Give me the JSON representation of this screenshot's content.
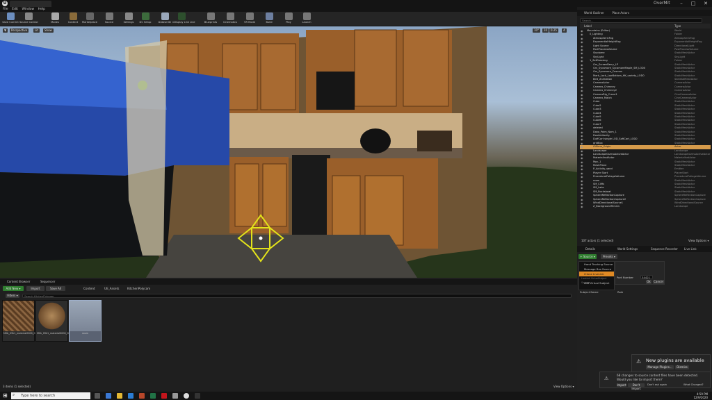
{
  "window": {
    "project": "OverMit",
    "min": "–",
    "max": "□",
    "close": "✕"
  },
  "menu": [
    "File",
    "Edit",
    "Window",
    "Help"
  ],
  "toolbar": [
    {
      "label": "Save Current",
      "icon": "save-icon",
      "color": "#6c8ebf"
    },
    {
      "label": "Source Control",
      "icon": "source-control-icon",
      "color": "#888"
    },
    {
      "label": "Modes",
      "icon": "modes-icon",
      "color": "#aaa"
    },
    {
      "label": "Content",
      "icon": "content-icon",
      "color": "#8a6b3a"
    },
    {
      "label": "Marketplace",
      "icon": "marketplace-icon",
      "color": "#666"
    },
    {
      "label": "Source",
      "icon": "source-icon",
      "color": "#777"
    },
    {
      "label": "Settings",
      "icon": "settings-icon",
      "color": "#888"
    },
    {
      "label": "DC Setup",
      "icon": "dc-setup-icon",
      "color": "#3c6b3c"
    },
    {
      "label": "Datasmith",
      "icon": "datasmith-icon",
      "color": "#9aa8bb"
    },
    {
      "label": "nDisplay Link Live",
      "icon": "ndisplay-icon",
      "color": "#2d4f2d"
    },
    {
      "label": "Blueprints",
      "icon": "blueprints-icon",
      "color": "#777"
    },
    {
      "label": "Cinematics",
      "icon": "cinematics-icon",
      "color": "#777"
    },
    {
      "label": "VR Mode",
      "icon": "vr-mode-icon",
      "color": "#777"
    },
    {
      "label": "Build",
      "icon": "build-icon",
      "color": "#6d7fa0"
    },
    {
      "label": "Play",
      "icon": "play-icon",
      "color": "#777"
    },
    {
      "label": "Launch",
      "icon": "launch-icon",
      "color": "#777"
    }
  ],
  "viewport": {
    "perspective": "Perspective",
    "lit": "Lit",
    "show": "Show",
    "snap1": "10°",
    "snap2": "10",
    "speed": "0.25",
    "cam": "4"
  },
  "outliner": {
    "tabs": [
      "World Outliner",
      "Place Actors"
    ],
    "search_placeholder": "Search...",
    "col_label": "Label",
    "col_type": "Type",
    "rows": [
      [
        "Mountains (Editor)",
        "World"
      ],
      [
        "0_Lighting",
        "Folder"
      ],
      [
        "AtmosphericFog",
        "AtmosphericFog"
      ],
      [
        "ExponentialHeightFog",
        "ExponentialHeightFog"
      ],
      [
        "Light Source",
        "DirectionalLight"
      ],
      [
        "PostProcessVolume",
        "PostProcessVolume"
      ],
      [
        "Skydome",
        "StaticMeshActor"
      ],
      [
        "SkyLight",
        "SkyLight"
      ],
      [
        "1_SetDressing",
        "Folder"
      ],
      [
        "Grs_ScreenBerry_LP",
        "StaticMeshActor"
      ],
      [
        "Grs_Sycamore_SycamoreMaple_SM_LOD0",
        "StaticMeshActor"
      ],
      [
        "Grs_Sycamore_Cosmos",
        "StaticMeshActor"
      ],
      [
        "Mark_Lock_LowBottom_HK_variety_LOD0",
        "StaticMeshActor"
      ],
      [
        "Bird_Animation",
        "SkeletalMeshActor"
      ],
      [
        "CameraActor",
        "CameraActor"
      ],
      [
        "Camera_Chimney",
        "CameraActor"
      ],
      [
        "Camera_Chimney2",
        "CameraActor"
      ],
      [
        "CameraRig_Crane1",
        "CineCameraActor"
      ],
      [
        "Camera_Match",
        "CineCameraActor"
      ],
      [
        "Cube",
        "StaticMeshActor"
      ],
      [
        "Cube2",
        "StaticMeshActor"
      ],
      [
        "Cube3",
        "StaticMeshActor"
      ],
      [
        "Cube4",
        "StaticMeshActor"
      ],
      [
        "Cube5",
        "StaticMeshActor"
      ],
      [
        "Cube6",
        "StaticMeshActor"
      ],
      [
        "Cube7",
        "StaticMeshActor"
      ],
      [
        "deleted",
        "StaticMeshActor"
      ],
      [
        "Dako_Palm_Nom_1",
        "StaticMeshActor"
      ],
      [
        "DoubleVanity",
        "StaticMeshActor"
      ],
      [
        "DuffCart single LOD_SoftCart_LOD0",
        "StaticMeshActor"
      ],
      [
        "gridBox",
        "StaticMeshActor"
      ],
      [
        "iOSime_Origin",
        "Actor"
      ],
      [
        "Landscape",
        "Landscape"
      ],
      [
        "LandscapeGizmoActiveActor",
        "LandscapeGizmoActiveActor"
      ],
      [
        "MaterialInstActor",
        "MaterialInstActor"
      ],
      [
        "Mpc_1",
        "StaticMeshActor"
      ],
      [
        "MeshPlane",
        "StaticMeshActor"
      ],
      [
        "P_Activity_sand",
        "Emitter"
      ],
      [
        "Player Start",
        "PlayerStart"
      ],
      [
        "ProceduralFoliageVolume",
        "ProceduralFoliageVolume"
      ],
      [
        "room",
        "StaticMeshActor"
      ],
      [
        "SM_Cliffs",
        "StaticMeshActor"
      ],
      [
        "SM_Lake",
        "StaticMeshActor"
      ],
      [
        "SM_Rocksboat",
        "StaticMeshActor"
      ],
      [
        "SphereReflectionCapture",
        "SphereReflectionCapture"
      ],
      [
        "SphereReflectionCapture2",
        "SphereReflectionCapture"
      ],
      [
        "WindDirectionalSource1",
        "WindDirectionalSource"
      ],
      [
        "Z_BackgroundTerrain",
        "Landscape"
      ]
    ],
    "selected": 31,
    "status": "107 actors (1 selected)",
    "view_options": "View Options ▾"
  },
  "details": {
    "tabs": [
      "Details",
      "World Settings",
      "Sequence Recorder",
      "Live Link"
    ],
    "source_btn": "+ Source ▾",
    "presets_btn": "Presets ▾",
    "menu": [
      "Hand Tracking Source",
      "Message Bus Source",
      "iClone LiveLink"
    ],
    "port_label": "Port Number",
    "port_value": "34421",
    "ok": "Ok",
    "cancel": "Cancel",
    "vs_header": "LiveLink VirtualSubject Sources",
    "add_vs": "Add Virtual Subject",
    "subject_label": "Subject Name",
    "subject_value": "Role"
  },
  "notify": {
    "title": "New plugins are available",
    "manage": "Manage Plugins...",
    "dismiss": "Dismiss",
    "msg1": "68 changes to source content files have been detected.",
    "msg2": "Would you like to import them?",
    "import": "Import",
    "dont": "Don't Import",
    "dontask": "Don't ask again",
    "what": "What Changed?"
  },
  "browser": {
    "tabs": [
      "Content Browser",
      "Sequencer"
    ],
    "add_new": "Add New ▾",
    "import": "Import",
    "save_all": "Save All",
    "path": [
      "Content",
      "UE_Assets",
      "KitchenPolycam"
    ],
    "filters": "Filters ▾",
    "search_placeholder": "Search KitchenPolycam",
    "assets": [
      {
        "name": "M0b_09k1_material0000_001_fib_dict_diffuse"
      },
      {
        "name": "M0k_09k1_material0000_001_baked"
      },
      {
        "name": "room"
      }
    ],
    "status": "3 items (1 selected)",
    "view_options": "View Options ▾"
  },
  "taskbar": {
    "search": "Type here to search",
    "time": "4:59 PM",
    "date": "12/9/2020"
  }
}
